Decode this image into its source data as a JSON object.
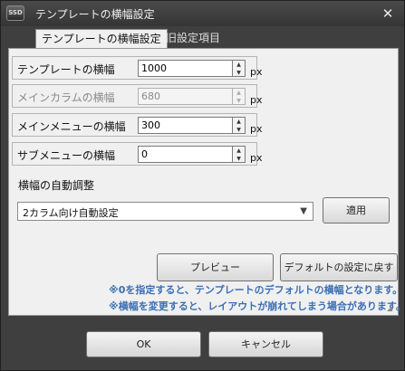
{
  "window": {
    "title": "テンプレートの横幅設定",
    "app_icon_text": "SSD",
    "close_symbol": "✕"
  },
  "tabs": [
    {
      "label": "テンプレートの横幅設定",
      "active": true
    },
    {
      "label": "旧設定項目",
      "active": false
    }
  ],
  "fields": [
    {
      "label": "テンプレートの横幅",
      "value": "1000",
      "unit": "px",
      "enabled": true
    },
    {
      "label": "メインカラムの横幅",
      "value": "680",
      "unit": "px",
      "enabled": false
    },
    {
      "label": "メインメニューの横幅",
      "value": "300",
      "unit": "px",
      "enabled": true
    },
    {
      "label": "サブメニューの横幅",
      "value": "0",
      "unit": "px",
      "enabled": true
    }
  ],
  "auto_adjust": {
    "label": "横幅の自動調整",
    "selected": "2カラム向け自動設定",
    "apply_label": "適用"
  },
  "actions": {
    "preview_label": "プレビュー",
    "default_label": "デフォルトの設定に戻す"
  },
  "notes": [
    "※0を指定すると、テンプレートのデフォルトの横幅となります。",
    "※横幅を変更すると、レイアウトが崩れてしまう場合があります。"
  ],
  "footer": {
    "ok_label": "OK",
    "cancel_label": "キャンセル"
  },
  "colors": {
    "note_text": "#3b6fb3",
    "window_chrome": "#3f3f3f",
    "panel_bg": "#f0f0f0"
  }
}
